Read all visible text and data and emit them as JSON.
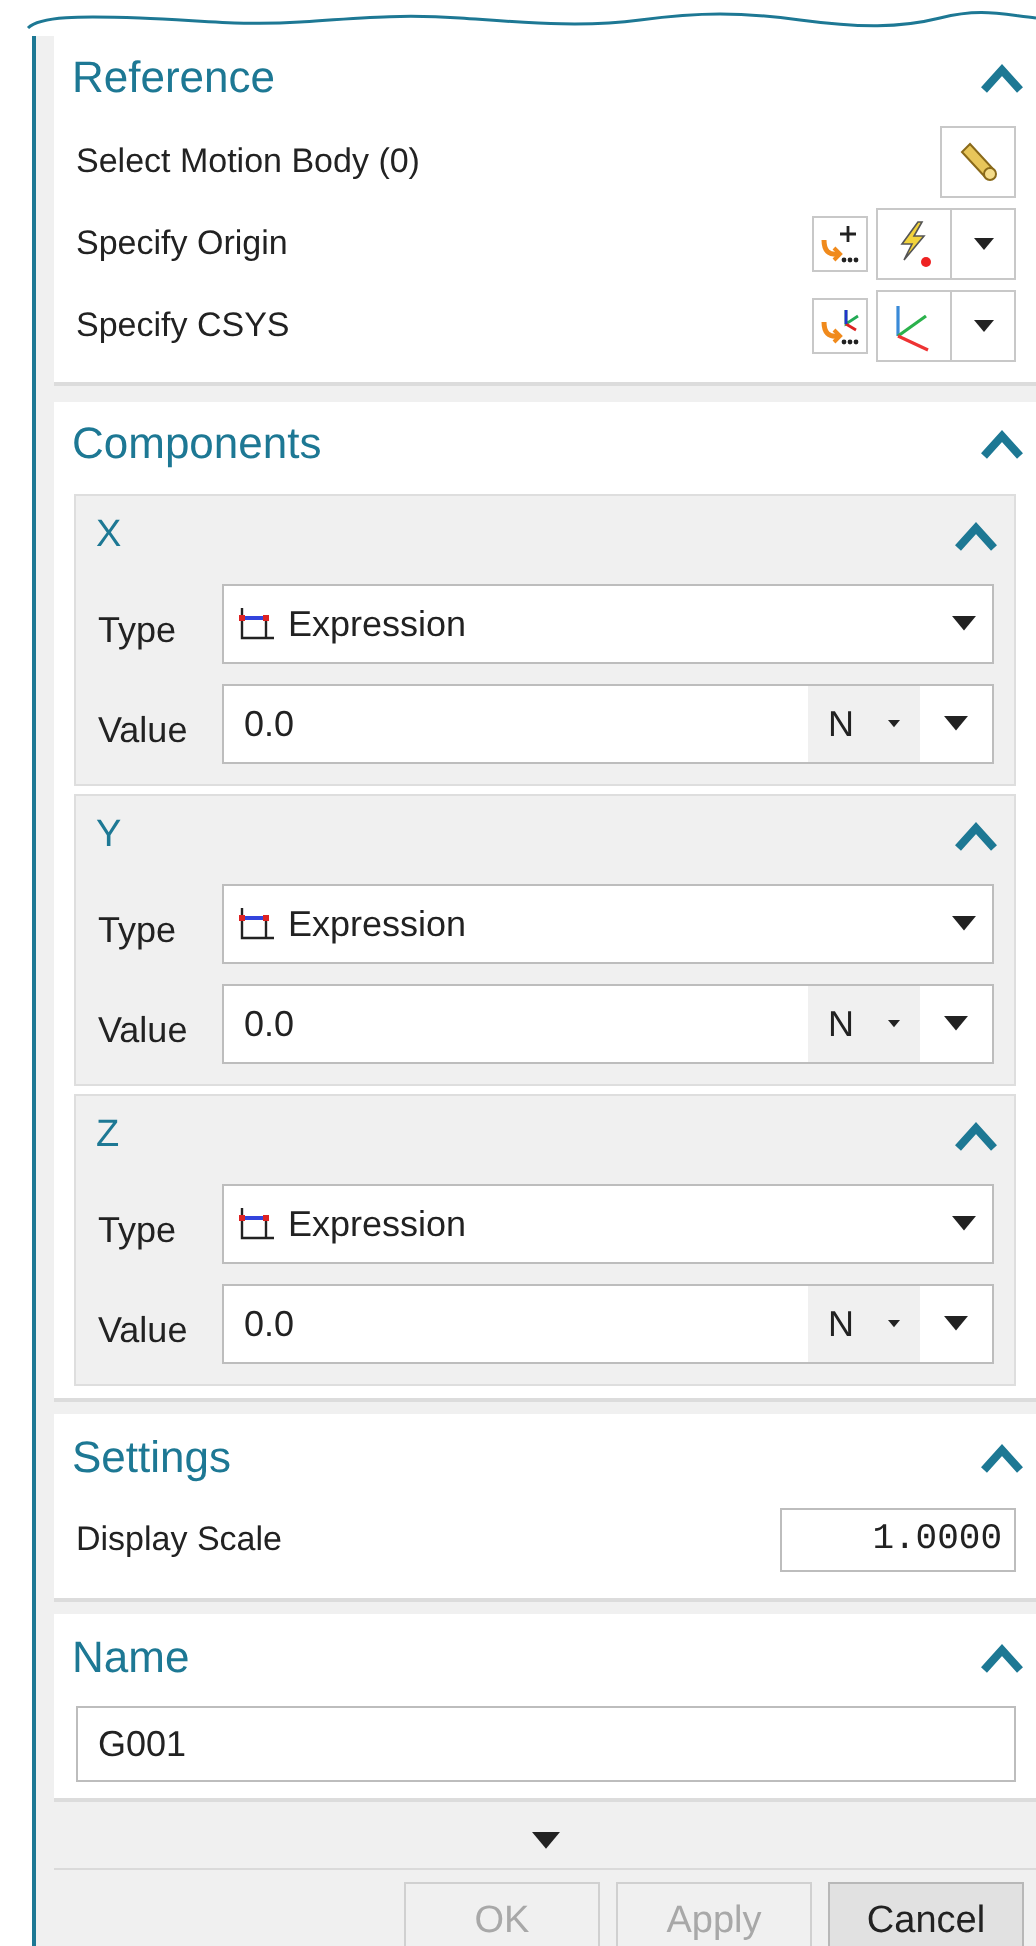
{
  "reference": {
    "title": "Reference",
    "expanded": true,
    "rows": [
      {
        "kind": "select",
        "label": "Select Motion Body (0)"
      },
      {
        "kind": "point",
        "label": "Specify Origin"
      },
      {
        "kind": "csys",
        "label": "Specify CSYS"
      }
    ]
  },
  "components": {
    "title": "Components",
    "expanded": true,
    "groups": [
      {
        "title": "X",
        "expanded": true,
        "type_label": "Type",
        "type": "Expression",
        "value_label": "Value",
        "value": "0.0",
        "unit": "N"
      },
      {
        "title": "Y",
        "expanded": true,
        "type_label": "Type",
        "type": "Expression",
        "value_label": "Value",
        "value": "0.0",
        "unit": "N"
      },
      {
        "title": "Z",
        "expanded": true,
        "type_label": "Type",
        "type": "Expression",
        "value_label": "Value",
        "value": "0.0",
        "unit": "N"
      }
    ]
  },
  "settings": {
    "title": "Settings",
    "expanded": true,
    "label": "Display Scale",
    "value": "1.0000"
  },
  "name": {
    "title": "Name",
    "expanded": true,
    "value": "G001"
  },
  "buttons": [
    {
      "label": "OK",
      "disabled": true
    },
    {
      "label": "Apply",
      "disabled": true
    },
    {
      "label": "Cancel",
      "disabled": false
    }
  ]
}
